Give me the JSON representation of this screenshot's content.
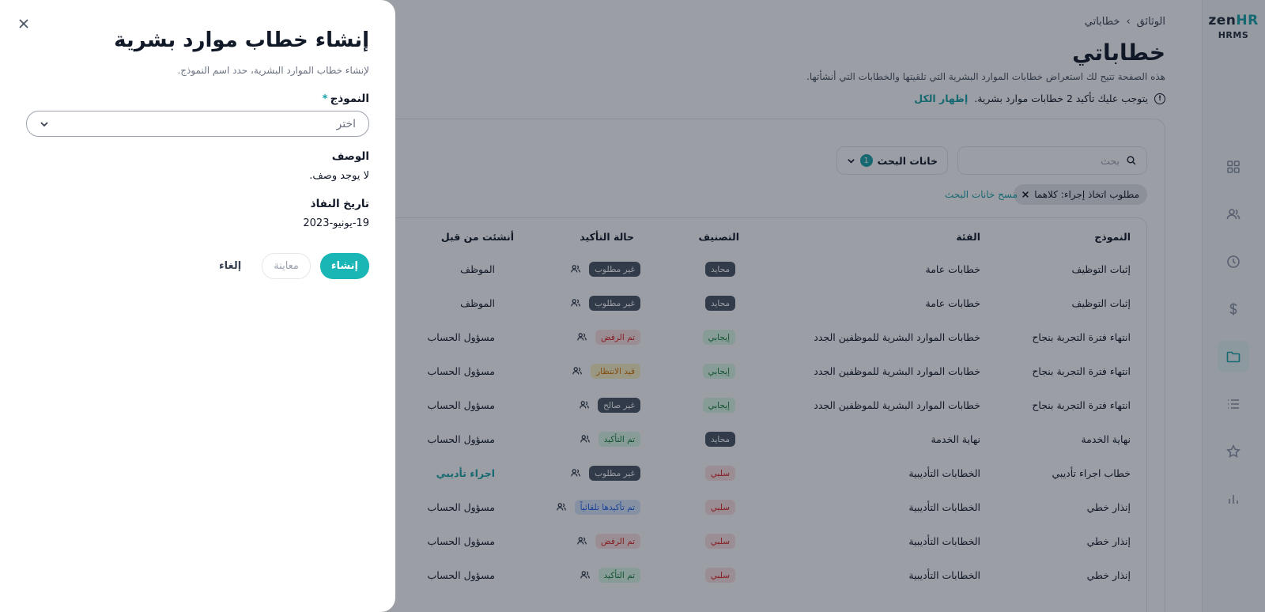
{
  "brand": {
    "name_zen": "zen",
    "name_hr": "HR",
    "sub": "HRMS"
  },
  "sidebar": {
    "items": [
      {
        "name": "dashboard-icon"
      },
      {
        "name": "users-icon"
      },
      {
        "name": "clock-icon"
      },
      {
        "name": "dollar-icon"
      },
      {
        "name": "folder-icon",
        "active": true
      },
      {
        "name": "list-icon"
      },
      {
        "name": "star-icon"
      },
      {
        "name": "bar-chart-icon"
      }
    ]
  },
  "breadcrumb": {
    "parent": "الوثائق",
    "separator": "›",
    "current": "خطاباتي"
  },
  "page": {
    "title": "خطاباتي",
    "description": "هذه الصفحة تتيح لك استعراض خطابات الموارد البشرية التي تلقيتها والخطابات التي أنشأتها.",
    "alert_text": "يتوجب عليك تأكيد 2 خطابات موارد بشرية.",
    "alert_link": "إظهار الكل"
  },
  "filters": {
    "search_placeholder": "بحث",
    "filter_button": "خانات البحث",
    "filter_count": "1",
    "chip_label": "مطلوب اتخاذ إجراء: كلاهما",
    "clear_link": "مسح خانات البحث"
  },
  "table": {
    "headers": {
      "template": "النموذج",
      "category": "الفئة",
      "classification": "التصنيف",
      "status": "حالة التأكيد",
      "created_by": "أنشئت من قبل"
    },
    "rows": [
      {
        "template": "إثبات التوظيف",
        "category": "خطابات عامة",
        "classification": "محايد",
        "status": "غير مطلوب",
        "created_by": "الموظف"
      },
      {
        "template": "إثبات التوظيف",
        "category": "خطابات عامة",
        "classification": "محايد",
        "status": "غير مطلوب",
        "created_by": "الموظف"
      },
      {
        "template": "انتهاء فترة التجربة بنجاح",
        "category": "خطابات الموارد البشرية للموظفين الجدد",
        "classification": "إيجابي",
        "status": "تم الرفض",
        "created_by": "مسؤول الحساب"
      },
      {
        "template": "انتهاء فترة التجربة بنجاح",
        "category": "خطابات الموارد البشرية للموظفين الجدد",
        "classification": "إيجابي",
        "status": "قيد الانتظار",
        "created_by": "مسؤول الحساب"
      },
      {
        "template": "انتهاء فترة التجربة بنجاح",
        "category": "خطابات الموارد البشرية للموظفين الجدد",
        "classification": "إيجابي",
        "status": "غير صالح",
        "created_by": "مسؤول الحساب"
      },
      {
        "template": "نهاية الخدمة",
        "category": "نهاية الخدمة",
        "classification": "محايد",
        "status": "تم التأكيد",
        "created_by": "مسؤول الحساب"
      },
      {
        "template": "خطاب اجراء تأديبي",
        "category": "الخطابات التأديبية",
        "classification": "سلبي",
        "status": "غير مطلوب",
        "created_by": "اجراء تأديبي"
      },
      {
        "template": "إنذار خطي",
        "category": "الخطابات التأديبية",
        "classification": "سلبي",
        "status": "تم تأكيدها تلقائياً",
        "created_by": "مسؤول الحساب"
      },
      {
        "template": "إنذار خطي",
        "category": "الخطابات التأديبية",
        "classification": "سلبي",
        "status": "تم الرفض",
        "created_by": "مسؤول الحساب"
      },
      {
        "template": "إنذار خطي",
        "category": "الخطابات التأديبية",
        "classification": "سلبي",
        "status": "تم التأكيد",
        "created_by": "مسؤول الحساب"
      }
    ]
  },
  "dialog": {
    "title": "إنشاء خطاب موارد بشرية",
    "subtitle": "لإنشاء خطاب الموارد البشرية، حدد اسم النموذج.",
    "template_label": "النموذج",
    "required_mark": "*",
    "template_placeholder": "اختر",
    "description_label": "الوصف",
    "description_value": "لا يوجد وصف.",
    "effective_date_label": "تاريخ النفاذ",
    "effective_date_value": "19-يونيو-2023",
    "create_button": "إنشاء",
    "preview_button": "معاينة",
    "cancel_button": "إلغاء"
  },
  "colors": {
    "accent": "#1ab5b5",
    "neutral_badge": "#4b5563",
    "positive_badge": "#16a34a",
    "negative_badge": "#dc2626"
  }
}
